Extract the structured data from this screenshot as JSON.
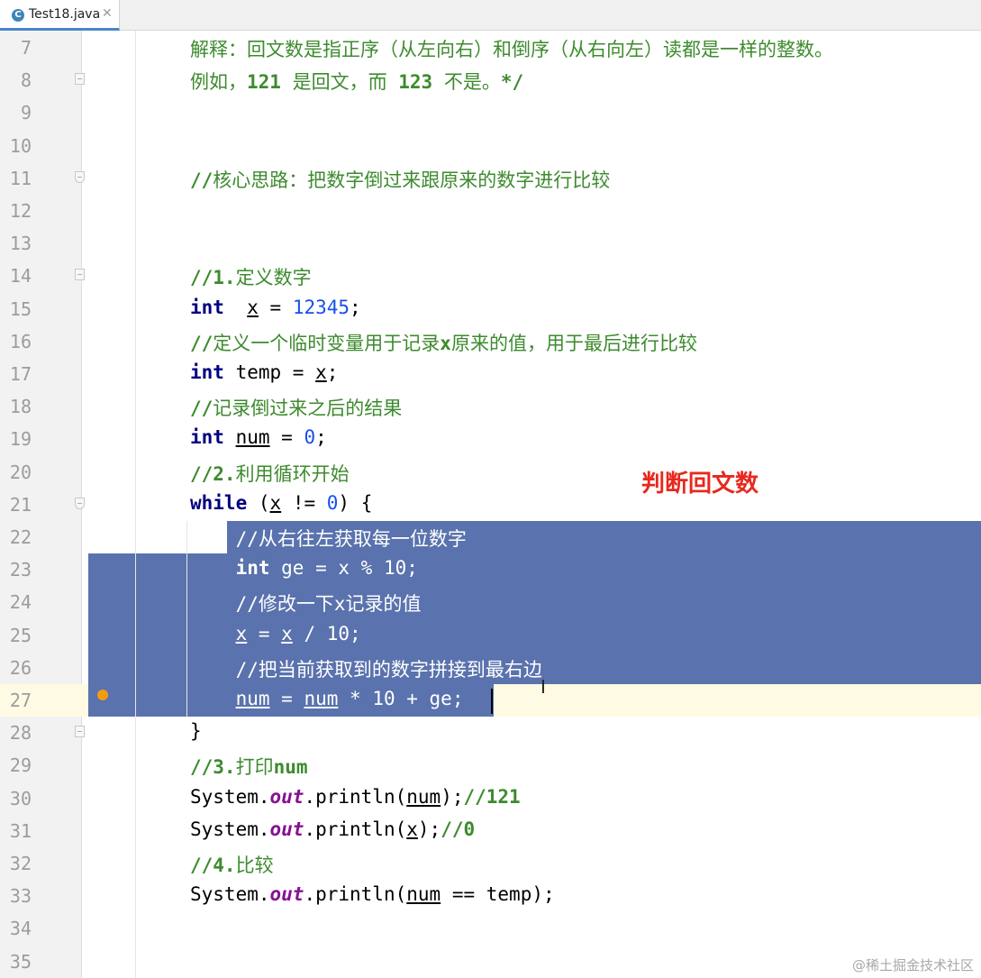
{
  "tab": {
    "icon_letter": "C",
    "filename": "Test18.java",
    "close": "✕"
  },
  "annotation": "判断回文数",
  "watermark": "@稀土掘金技术社区",
  "lines": [
    {
      "n": "7",
      "code": [
        [
          "cm",
          "解释：回文数是指正序（从左向右）和倒序（从右向左）读都是一样的整数。"
        ]
      ]
    },
    {
      "n": "8",
      "code": [
        [
          "cm",
          "例如，"
        ],
        [
          "cmb",
          "121"
        ],
        [
          "cm",
          " 是回文，而 "
        ],
        [
          "cmb",
          "123"
        ],
        [
          "cm",
          " 不是。"
        ],
        [
          "cmb",
          "*/"
        ]
      ]
    },
    {
      "n": "9",
      "code": []
    },
    {
      "n": "10",
      "code": []
    },
    {
      "n": "11",
      "code": [
        [
          "cmb",
          "//"
        ],
        [
          "cm",
          "核心思路：把数字倒过来跟原来的数字进行比较"
        ]
      ]
    },
    {
      "n": "12",
      "code": []
    },
    {
      "n": "13",
      "code": []
    },
    {
      "n": "14",
      "code": [
        [
          "cmb",
          "//1."
        ],
        [
          "cm",
          "定义数字"
        ]
      ]
    },
    {
      "n": "15",
      "code": [
        [
          "kw",
          "int"
        ],
        [
          "",
          "  "
        ],
        [
          "ul",
          "x"
        ],
        [
          "",
          " = "
        ],
        [
          "num",
          "12345"
        ],
        [
          "",
          ";"
        ]
      ]
    },
    {
      "n": "16",
      "code": [
        [
          "cmb",
          "//"
        ],
        [
          "cm",
          "定义一个临时变量用于记录"
        ],
        [
          "cmb",
          "x"
        ],
        [
          "cm",
          "原来的值，用于最后进行比较"
        ]
      ]
    },
    {
      "n": "17",
      "code": [
        [
          "kw",
          "int"
        ],
        [
          "",
          " temp = "
        ],
        [
          "ul",
          "x"
        ],
        [
          "",
          ";"
        ]
      ]
    },
    {
      "n": "18",
      "code": [
        [
          "cmb",
          "//"
        ],
        [
          "cm",
          "记录倒过来之后的结果"
        ]
      ]
    },
    {
      "n": "19",
      "code": [
        [
          "kw",
          "int"
        ],
        [
          "",
          " "
        ],
        [
          "ul",
          "num"
        ],
        [
          "",
          " = "
        ],
        [
          "num",
          "0"
        ],
        [
          "",
          ";"
        ]
      ]
    },
    {
      "n": "20",
      "code": [
        [
          "cmb",
          "//2."
        ],
        [
          "cm",
          "利用循环开始"
        ]
      ]
    },
    {
      "n": "21",
      "code": [
        [
          "kw",
          "while"
        ],
        [
          "",
          " ("
        ],
        [
          "ul",
          "x"
        ],
        [
          "",
          " != "
        ],
        [
          "num",
          "0"
        ],
        [
          "",
          ") {"
        ]
      ]
    },
    {
      "n": "22",
      "code": [
        [
          "w",
          "    //从右往左获取每一位数字"
        ]
      ]
    },
    {
      "n": "23",
      "code": [
        [
          "w",
          "    "
        ],
        [
          "wk",
          "int"
        ],
        [
          "w",
          " ge = x % 10;"
        ]
      ]
    },
    {
      "n": "24",
      "code": [
        [
          "w",
          "    //修改一下x记录的值"
        ]
      ]
    },
    {
      "n": "25",
      "code": [
        [
          "w",
          "    "
        ],
        [
          "w ul",
          "x"
        ],
        [
          "w",
          " = "
        ],
        [
          "w ul",
          "x"
        ],
        [
          "w",
          " / 10;"
        ]
      ]
    },
    {
      "n": "26",
      "code": [
        [
          "w",
          "    //把当前获取到的数字拼接到最右边"
        ]
      ]
    },
    {
      "n": "27",
      "code": [
        [
          "w",
          "    "
        ],
        [
          "w ul",
          "num"
        ],
        [
          "w",
          " = "
        ],
        [
          "w ul",
          "num"
        ],
        [
          "w",
          " * 10 + ge;"
        ]
      ]
    },
    {
      "n": "28",
      "code": [
        [
          "",
          "}"
        ]
      ]
    },
    {
      "n": "29",
      "code": [
        [
          "cmb",
          "//3."
        ],
        [
          "cm",
          "打印"
        ],
        [
          "cmb",
          "num"
        ]
      ]
    },
    {
      "n": "30",
      "code": [
        [
          "",
          "System."
        ],
        [
          "fld",
          "out"
        ],
        [
          "",
          ".println("
        ],
        [
          "ul",
          "num"
        ],
        [
          "",
          ");"
        ],
        [
          "cmb",
          "//121"
        ]
      ]
    },
    {
      "n": "31",
      "code": [
        [
          "",
          "System."
        ],
        [
          "fld",
          "out"
        ],
        [
          "",
          ".println("
        ],
        [
          "ul",
          "x"
        ],
        [
          "",
          ");"
        ],
        [
          "cmb",
          "//0"
        ]
      ]
    },
    {
      "n": "32",
      "code": [
        [
          "cmb",
          "//4."
        ],
        [
          "cm",
          "比较"
        ]
      ]
    },
    {
      "n": "33",
      "code": [
        [
          "",
          "System."
        ],
        [
          "fld",
          "out"
        ],
        [
          "",
          ".println("
        ],
        [
          "ul",
          "num"
        ],
        [
          "",
          " == temp);"
        ]
      ]
    },
    {
      "n": "34",
      "code": []
    },
    {
      "n": "35",
      "code": []
    }
  ]
}
